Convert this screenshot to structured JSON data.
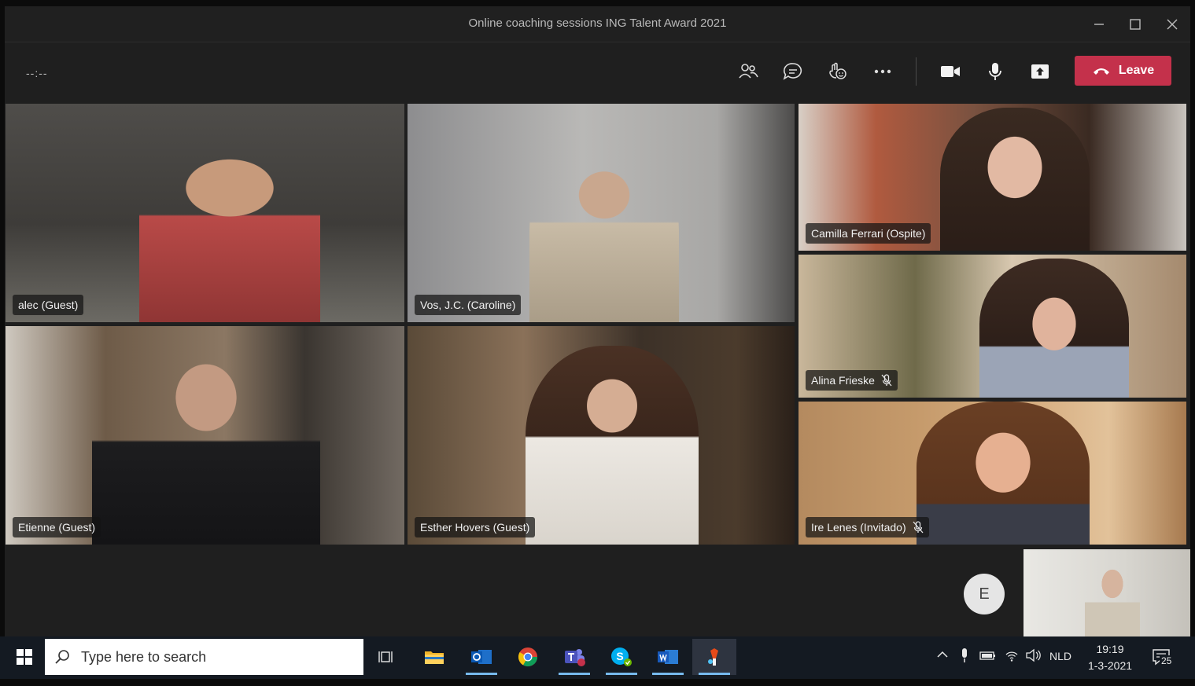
{
  "window": {
    "title": "Online coaching sessions ING Talent Award 2021"
  },
  "toolbar": {
    "timer": "--:--",
    "leave_label": "Leave"
  },
  "participants": [
    {
      "name": "alec (Guest)",
      "muted": false
    },
    {
      "name": "Vos, J.C. (Caroline)",
      "muted": false
    },
    {
      "name": "Camilla Ferrari (Ospite)",
      "muted": false
    },
    {
      "name": "Alina Frieske",
      "muted": true
    },
    {
      "name": "Etienne (Guest)",
      "muted": false
    },
    {
      "name": "Esther Hovers (Guest)",
      "muted": false
    },
    {
      "name": "Ire Lenes (Invitado)",
      "muted": true
    }
  ],
  "avatar": {
    "initial": "E"
  },
  "taskbar": {
    "search_placeholder": "Type here to search",
    "language": "NLD",
    "time": "19:19",
    "date": "1-3-2021",
    "notifications": "25"
  },
  "colors": {
    "leave": "#c4314b",
    "taskbar": "#141a22",
    "window": "#1f1f1f"
  }
}
